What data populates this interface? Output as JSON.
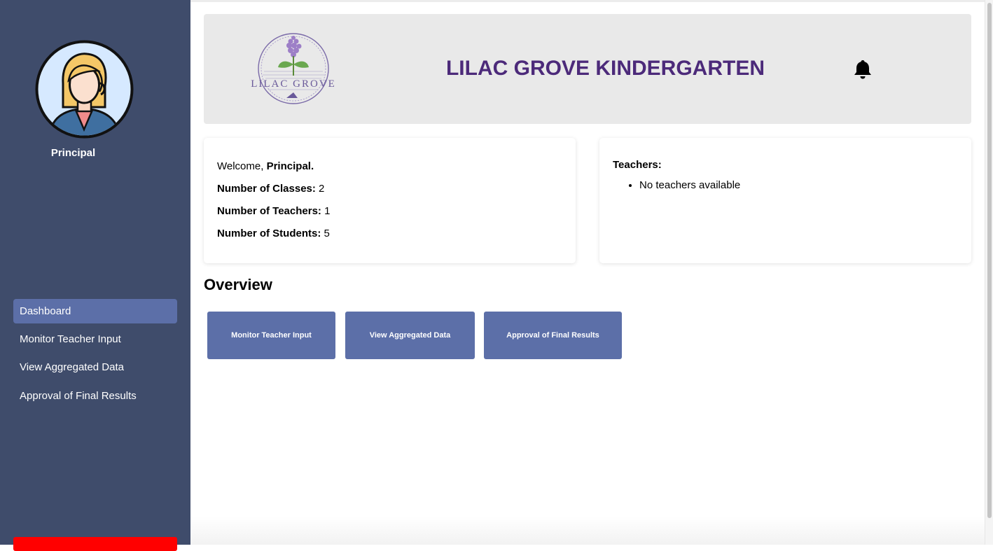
{
  "sidebar": {
    "role": "Principal",
    "nav": [
      {
        "label": "Dashboard",
        "active": true
      },
      {
        "label": "Monitor Teacher Input",
        "active": false
      },
      {
        "label": "View Aggregated Data",
        "active": false
      },
      {
        "label": "Approval of Final Results",
        "active": false
      }
    ],
    "avatar_icon": "principal-avatar-icon",
    "logout_color": "#ff0000"
  },
  "header": {
    "logo_text": "LILAC GROVE",
    "title": "LILAC GROVE KINDERGARTEN",
    "title_color": "#4c2a7a",
    "notification_icon": "bell-icon"
  },
  "summary": {
    "welcome_prefix": "Welcome,",
    "welcome_name": "Principal.",
    "classes_label": "Number of Classes:",
    "classes_value": "2",
    "teachers_label": "Number of Teachers:",
    "teachers_value": "1",
    "students_label": "Number of Students:",
    "students_value": "5"
  },
  "teachers_card": {
    "heading": "Teachers:",
    "items": [
      "No teachers available"
    ]
  },
  "overview": {
    "title": "Overview",
    "buttons": [
      "Monitor Teacher Input",
      "View Aggregated Data",
      "Approval of Final Results"
    ]
  },
  "colors": {
    "sidebar": "#3f4c6b",
    "accent": "#5c6fa8",
    "header_bg": "#e9e9e9"
  }
}
